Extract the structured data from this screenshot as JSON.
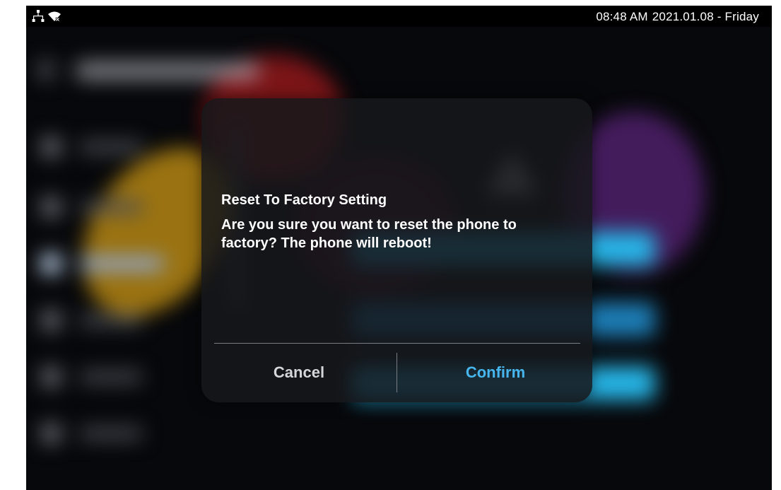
{
  "status_bar": {
    "time": "08:48 AM",
    "date": "2021.01.08 - Friday",
    "icons": [
      "network-icon",
      "wifi-disconnected-icon"
    ]
  },
  "dialog": {
    "title": "Reset To Factory Setting",
    "message": "Are you sure you want to reset the phone to factory? The phone will reboot!",
    "cancel_label": "Cancel",
    "confirm_label": "Confirm"
  },
  "colors": {
    "confirm_accent": "#47b6ef",
    "dialog_background": "#16171b",
    "status_bar_background": "#000000"
  }
}
